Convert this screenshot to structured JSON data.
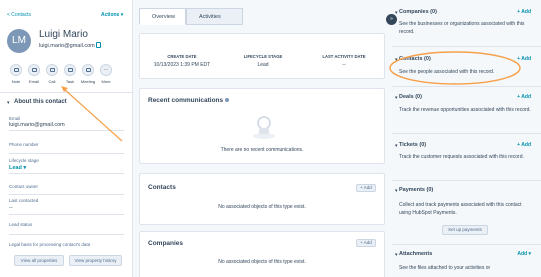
{
  "sidebar": {
    "back_label": "< Contacts",
    "actions_label": "Actions ▾",
    "avatar_initials": "LM",
    "contact_name": "Luigi Mario",
    "contact_email": "luigi.mario@gmail.com",
    "actions": [
      {
        "label": "Note",
        "icon": "note-icon"
      },
      {
        "label": "Email",
        "icon": "email-icon"
      },
      {
        "label": "Call",
        "icon": "call-icon"
      },
      {
        "label": "Task",
        "icon": "task-icon"
      },
      {
        "label": "Meeting",
        "icon": "meeting-icon"
      },
      {
        "label": "More",
        "icon": "more-icon"
      }
    ],
    "about_title": "About this contact",
    "properties": [
      {
        "label": "Email",
        "value": "luigi.mario@gmail.com"
      },
      {
        "label": "Phone number",
        "value": ""
      },
      {
        "label": "Lifecycle stage",
        "value": "Lead ▾"
      },
      {
        "label": "Contact owner",
        "value": ""
      },
      {
        "label": "Last contacted",
        "value": "--"
      },
      {
        "label": "Lead status",
        "value": ""
      }
    ],
    "legal_label": "Legal basis for processing contact's data",
    "view_all_properties": "View all properties",
    "view_property_history": "View property history"
  },
  "main": {
    "tabs": [
      {
        "label": "Overview",
        "active": true
      },
      {
        "label": "Activities",
        "active": false
      }
    ],
    "stats": [
      {
        "label": "CREATE DATE",
        "value": "10/13/2023 1:39 PM EDT"
      },
      {
        "label": "LIFECYCLE STAGE",
        "value": "Lead"
      },
      {
        "label": "LAST ACTIVITY DATE",
        "value": "--"
      }
    ],
    "recent_title": "Recent communications",
    "recent_empty": "There are no recent communications.",
    "contacts_title": "Contacts",
    "contacts_empty": "No associated objects of this type exist.",
    "companies_title": "Companies",
    "add_label": "+ Add"
  },
  "right": {
    "companies": {
      "title": "Companies (0)",
      "add": "+ Add",
      "desc": "See the businesses or organizations associated with this record."
    },
    "contacts": {
      "title": "Contacts (0)",
      "add": "+ Add",
      "desc": "See the people associated with this record."
    },
    "deals": {
      "title": "Deals (0)",
      "add": "+ Add",
      "desc": "Track the revenue opportunities associated with this record."
    },
    "tickets": {
      "title": "Tickets (0)",
      "add": "+ Add",
      "desc": "Track the customer requests associated with this record."
    },
    "payments": {
      "title": "Payments (0)",
      "desc": "Collect and track payments associated with this contact using HubSpot Payments.",
      "setup": "Set up payments"
    },
    "attachments": {
      "title": "Attachments",
      "add": "Add ▾",
      "desc": "See the files attached to your activities or"
    }
  },
  "colors": {
    "accent": "#0091ae",
    "annotation": "#f5a04a",
    "text": "#33475b"
  }
}
